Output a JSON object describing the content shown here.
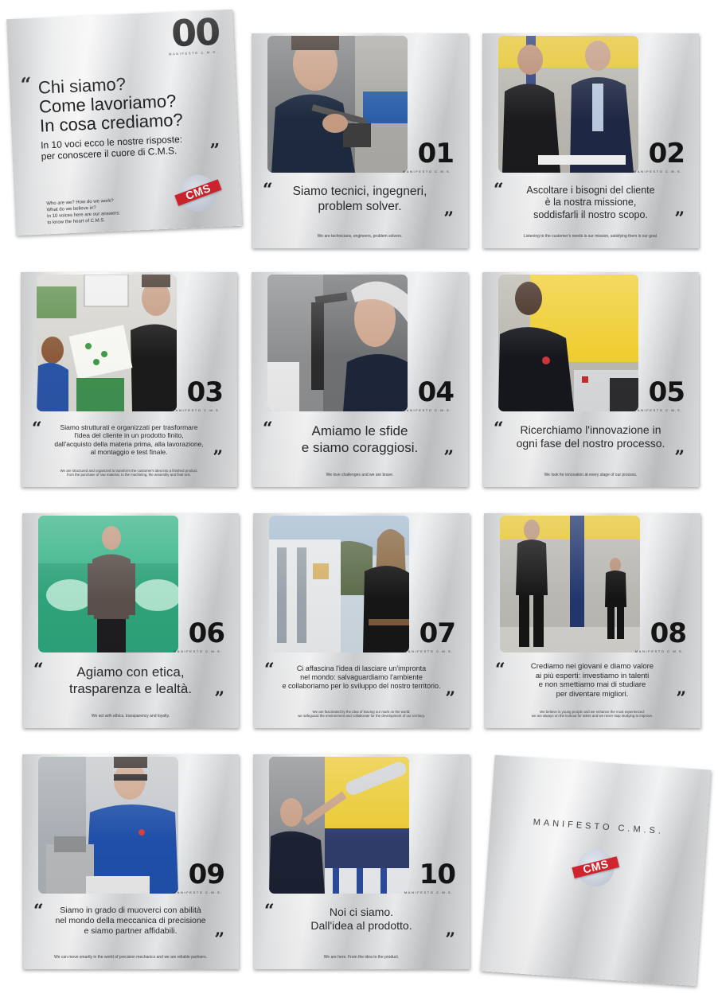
{
  "intro": {
    "number": "00",
    "manifesto_label": "MANIFESTO C.M.S.",
    "open_quote": "“",
    "close_quote": "”",
    "title_1": "Chi siamo?",
    "title_2": "Come lavoriamo?",
    "title_3": "In cosa crediamo?",
    "lead_1": "In 10 voci ecco le nostre risposte:",
    "lead_2": "per conoscere il cuore di C.M.S.",
    "en_1": "Who are we? How do we work?",
    "en_2": "What do we believe in?",
    "en_3": "In 10 voices here are our answers:",
    "en_4": "to know the heart of C.M.S.",
    "logo_text": "CMS"
  },
  "cards": [
    {
      "number": "01",
      "label": "MANIFESTO C.M.S.",
      "open_quote": "“",
      "close_quote": "”",
      "it": [
        "Siamo tecnici, ingegneri,",
        "problem solver."
      ],
      "en": [
        "We are technicians, engineers, problem solvers."
      ]
    },
    {
      "number": "02",
      "label": "MANIFESTO C.M.S.",
      "open_quote": "“",
      "close_quote": "”",
      "it": [
        "Ascoltare i bisogni del cliente",
        "è la nostra missione,",
        "soddisfarli il nostro scopo."
      ],
      "en": [
        "Listening to the customer's needs is our mission, satisfying them is our goal."
      ]
    },
    {
      "number": "03",
      "label": "MANIFESTO C.M.S.",
      "open_quote": "“",
      "close_quote": "”",
      "it": [
        "Siamo strutturati e organizzati per trasformare",
        "l'idea del cliente in un prodotto finito,",
        "dall'acquisto della materia prima, alla lavorazione,",
        "al montaggio e test finale."
      ],
      "en": [
        "We are structured and organized to transform the customer's idea into a finished product,",
        "from the purchase of raw material, to the machining, the assembly and final test."
      ]
    },
    {
      "number": "04",
      "label": "MANIFESTO C.M.S.",
      "open_quote": "“",
      "close_quote": "”",
      "it": [
        "Amiamo le sfide",
        "e siamo coraggiosi."
      ],
      "en": [
        "We love challenges and we are brave."
      ]
    },
    {
      "number": "05",
      "label": "MANIFESTO C.M.S.",
      "open_quote": "“",
      "close_quote": "”",
      "it": [
        "Ricerchiamo l'innovazione in",
        "ogni fase del nostro processo."
      ],
      "en": [
        "We look for innovation at every stage of our process."
      ]
    },
    {
      "number": "06",
      "label": "MANIFESTO C.M.S.",
      "open_quote": "“",
      "close_quote": "”",
      "it": [
        "Agiamo con etica,",
        "trasparenza e lealtà."
      ],
      "en": [
        "We act with ethics, transparency and loyalty."
      ]
    },
    {
      "number": "07",
      "label": "MANIFESTO C.M.S.",
      "open_quote": "“",
      "close_quote": "”",
      "it": [
        "Ci affascina l'idea di lasciare un'impronta",
        "nel mondo: salvaguardiamo l'ambiente",
        "e collaboriamo per lo sviluppo del nostro territorio."
      ],
      "en": [
        "We are fascinated by the idea of leaving our mark on the world:",
        "we safeguard the environment and collaborate for the development of our territory."
      ]
    },
    {
      "number": "08",
      "label": "MANIFESTO C.M.S.",
      "open_quote": "“",
      "close_quote": "”",
      "it": [
        "Crediamo nei giovani e diamo valore",
        "ai più esperti: investiamo in talenti",
        "e non smettiamo mai di studiare",
        "per diventare migliori."
      ],
      "en": [
        "We believe in young people and we enhance the most experienced:",
        "we are always on the lookout for talent and we never stop studying to improve."
      ]
    },
    {
      "number": "09",
      "label": "MANIFESTO C.M.S.",
      "open_quote": "“",
      "close_quote": "”",
      "it": [
        "Siamo in grado di muoverci con abilità",
        "nel mondo della meccanica di precisione",
        "e siamo partner affidabili."
      ],
      "en": [
        "We can move smartly in the world of precision mechanics and we are reliable partners."
      ]
    },
    {
      "number": "10",
      "label": "MANIFESTO C.M.S.",
      "open_quote": "“",
      "close_quote": "”",
      "it": [
        "Noi ci siamo.",
        "Dall'idea al prodotto."
      ],
      "en": [
        "We are here. From the idea to the product."
      ]
    }
  ],
  "back_cover": {
    "title": "MANIFESTO C.M.S.",
    "logo_text": "CMS"
  },
  "colors": {
    "logo_red": "#d1242e",
    "logo_disc": "#c3cad6",
    "number_black": "#141414"
  }
}
